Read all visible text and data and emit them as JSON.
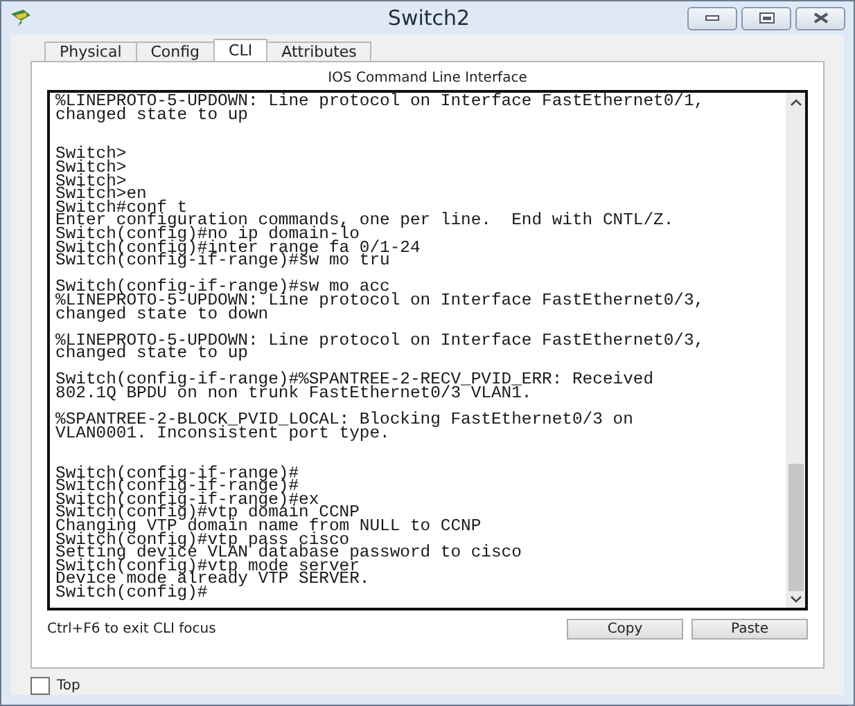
{
  "window": {
    "title": "Switch2"
  },
  "tabs": [
    {
      "label": "Physical",
      "selected": false
    },
    {
      "label": "Config",
      "selected": false
    },
    {
      "label": "CLI",
      "selected": true
    },
    {
      "label": "Attributes",
      "selected": false
    }
  ],
  "cli": {
    "heading": "IOS Command Line Interface",
    "lines": [
      {
        "kind": "text",
        "text": "%LINEPROTO-5-UPDOWN: Line protocol on Interface FastEthernet0/1,"
      },
      {
        "kind": "text",
        "text": "changed state to up"
      },
      {
        "kind": "blank"
      },
      {
        "kind": "blank"
      },
      {
        "kind": "text",
        "text": "Switch>"
      },
      {
        "kind": "text",
        "text": "Switch>"
      },
      {
        "kind": "text",
        "text": "Switch>"
      },
      {
        "kind": "text",
        "text": "Switch>en"
      },
      {
        "kind": "text",
        "text": "Switch#conf t"
      },
      {
        "kind": "text",
        "text": "Enter configuration commands, one per line.  End with CNTL/Z."
      },
      {
        "kind": "text",
        "text": "Switch(config)#no ip domain-lo"
      },
      {
        "kind": "text",
        "text": "Switch(config)#inter range fa 0/1-24"
      },
      {
        "kind": "text",
        "text": "Switch(config-if-range)#sw mo tru"
      },
      {
        "kind": "blank"
      },
      {
        "kind": "text",
        "text": "Switch(config-if-range)#sw mo acc"
      },
      {
        "kind": "text",
        "text": "%LINEPROTO-5-UPDOWN: Line protocol on Interface FastEthernet0/3,"
      },
      {
        "kind": "text",
        "text": "changed state to down"
      },
      {
        "kind": "blank"
      },
      {
        "kind": "text",
        "text": "%LINEPROTO-5-UPDOWN: Line protocol on Interface FastEthernet0/3,"
      },
      {
        "kind": "text",
        "text": "changed state to up"
      },
      {
        "kind": "blank"
      },
      {
        "kind": "text",
        "text": "Switch(config-if-range)#%SPANTREE-2-RECV_PVID_ERR: Received"
      },
      {
        "kind": "text",
        "text": "802.1Q BPDU on non trunk FastEthernet0/3 VLAN1."
      },
      {
        "kind": "blank"
      },
      {
        "kind": "text",
        "text": "%SPANTREE-2-BLOCK_PVID_LOCAL: Blocking FastEthernet0/3 on"
      },
      {
        "kind": "text",
        "text": "VLAN0001. Inconsistent port type."
      },
      {
        "kind": "blank"
      },
      {
        "kind": "blank"
      },
      {
        "kind": "text",
        "text": "Switch(config-if-range)#"
      },
      {
        "kind": "text",
        "text": "Switch(config-if-range)#"
      },
      {
        "kind": "text",
        "text": "Switch(config-if-range)#ex"
      },
      {
        "kind": "text",
        "text": "Switch(config)#vtp domain CCNP"
      },
      {
        "kind": "text",
        "text": "Changing VTP domain name from NULL to CCNP"
      },
      {
        "kind": "text",
        "text": "Switch(config)#vtp pass cisco"
      },
      {
        "kind": "text",
        "text": "Setting device VLAN database password to cisco"
      },
      {
        "kind": "text",
        "text": "Switch(config)#vtp mode server"
      },
      {
        "kind": "text",
        "text": "Device mode already VTP SERVER."
      },
      {
        "kind": "text",
        "text": "Switch(config)#"
      }
    ],
    "hint": "Ctrl+F6 to exit CLI focus",
    "buttons": [
      "Copy",
      "Paste"
    ]
  },
  "top_checkbox": {
    "label": "Top",
    "checked": false
  }
}
